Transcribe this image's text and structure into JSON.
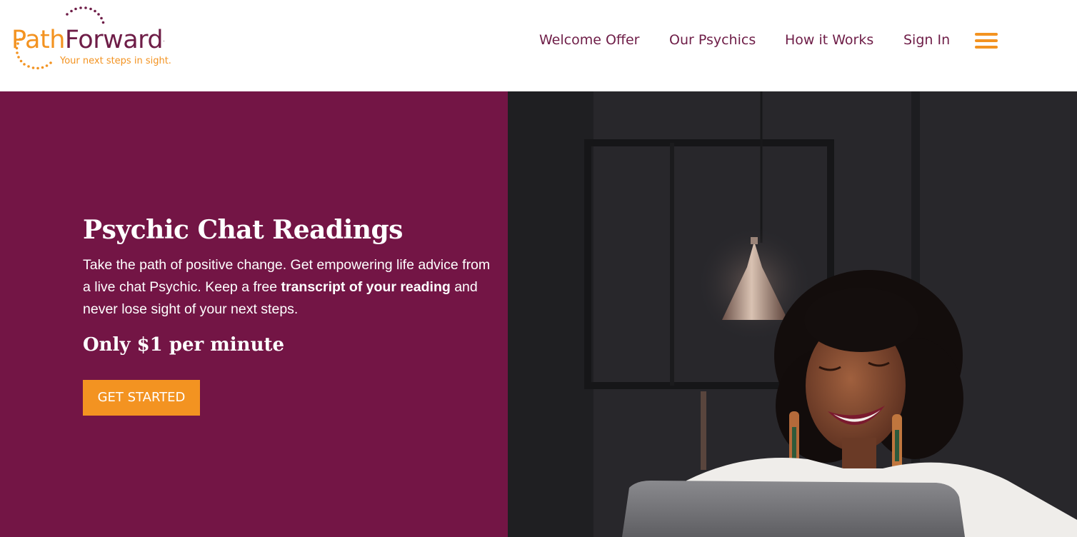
{
  "brand": {
    "name_part1": "Path",
    "name_part2": "Forward",
    "trademark": ".",
    "tagline": "Your next steps in sight.",
    "primary_color": "#731545",
    "accent_color": "#f39321"
  },
  "nav": {
    "items": [
      {
        "label": "Welcome Offer"
      },
      {
        "label": "Our Psychics"
      },
      {
        "label": "How it Works"
      },
      {
        "label": "Sign In"
      }
    ],
    "menu_icon": "hamburger-menu-icon"
  },
  "hero": {
    "title": "Psychic Chat Readings",
    "text_before": "Take the path of positive change. Get empowering life advice from a live chat Psychic. Keep a free ",
    "text_bold": "transcript of your reading",
    "text_after": " and never lose sight of your next steps.",
    "price": "Only $1 per minute",
    "cta_label": "GET STARTED"
  },
  "photo": {
    "subject": "smiling woman with laptop under pendant lamp"
  }
}
